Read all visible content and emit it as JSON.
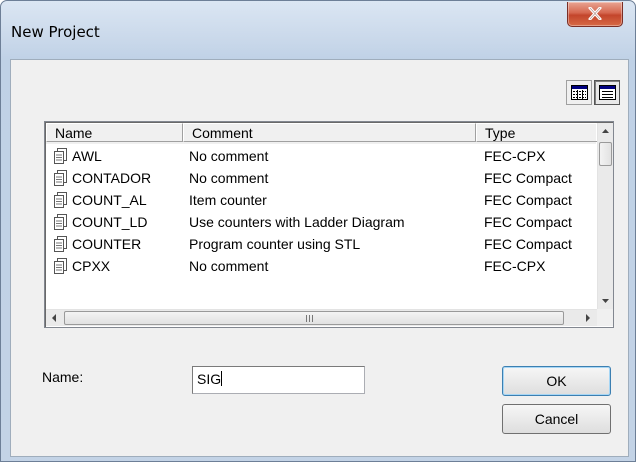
{
  "window": {
    "title": "New Project",
    "close_label": "X"
  },
  "toolbar": {
    "details_view_icon": "details-view-icon",
    "list_view_icon": "list-view-icon"
  },
  "list": {
    "columns": [
      "Name",
      "Comment",
      "Type"
    ],
    "rows": [
      {
        "name": "AWL",
        "comment": "No comment",
        "type": "FEC-CPX"
      },
      {
        "name": "CONTADOR",
        "comment": "No comment",
        "type": "FEC Compact"
      },
      {
        "name": "COUNT_AL",
        "comment": "Item counter",
        "type": "FEC Compact"
      },
      {
        "name": "COUNT_LD",
        "comment": "Use counters with Ladder Diagram",
        "type": "FEC Compact"
      },
      {
        "name": "COUNTER",
        "comment": "Program counter using STL",
        "type": "FEC Compact"
      },
      {
        "name": "CPXX",
        "comment": "No comment",
        "type": "FEC-CPX"
      }
    ]
  },
  "form": {
    "name_label": "Name:",
    "name_value": "SIG"
  },
  "buttons": {
    "ok_label": "OK",
    "cancel_label": "Cancel"
  },
  "colors": {
    "close_button": "#c3452c",
    "window_frame": "#bfd1e6",
    "client_bg": "#f0f0f0"
  }
}
